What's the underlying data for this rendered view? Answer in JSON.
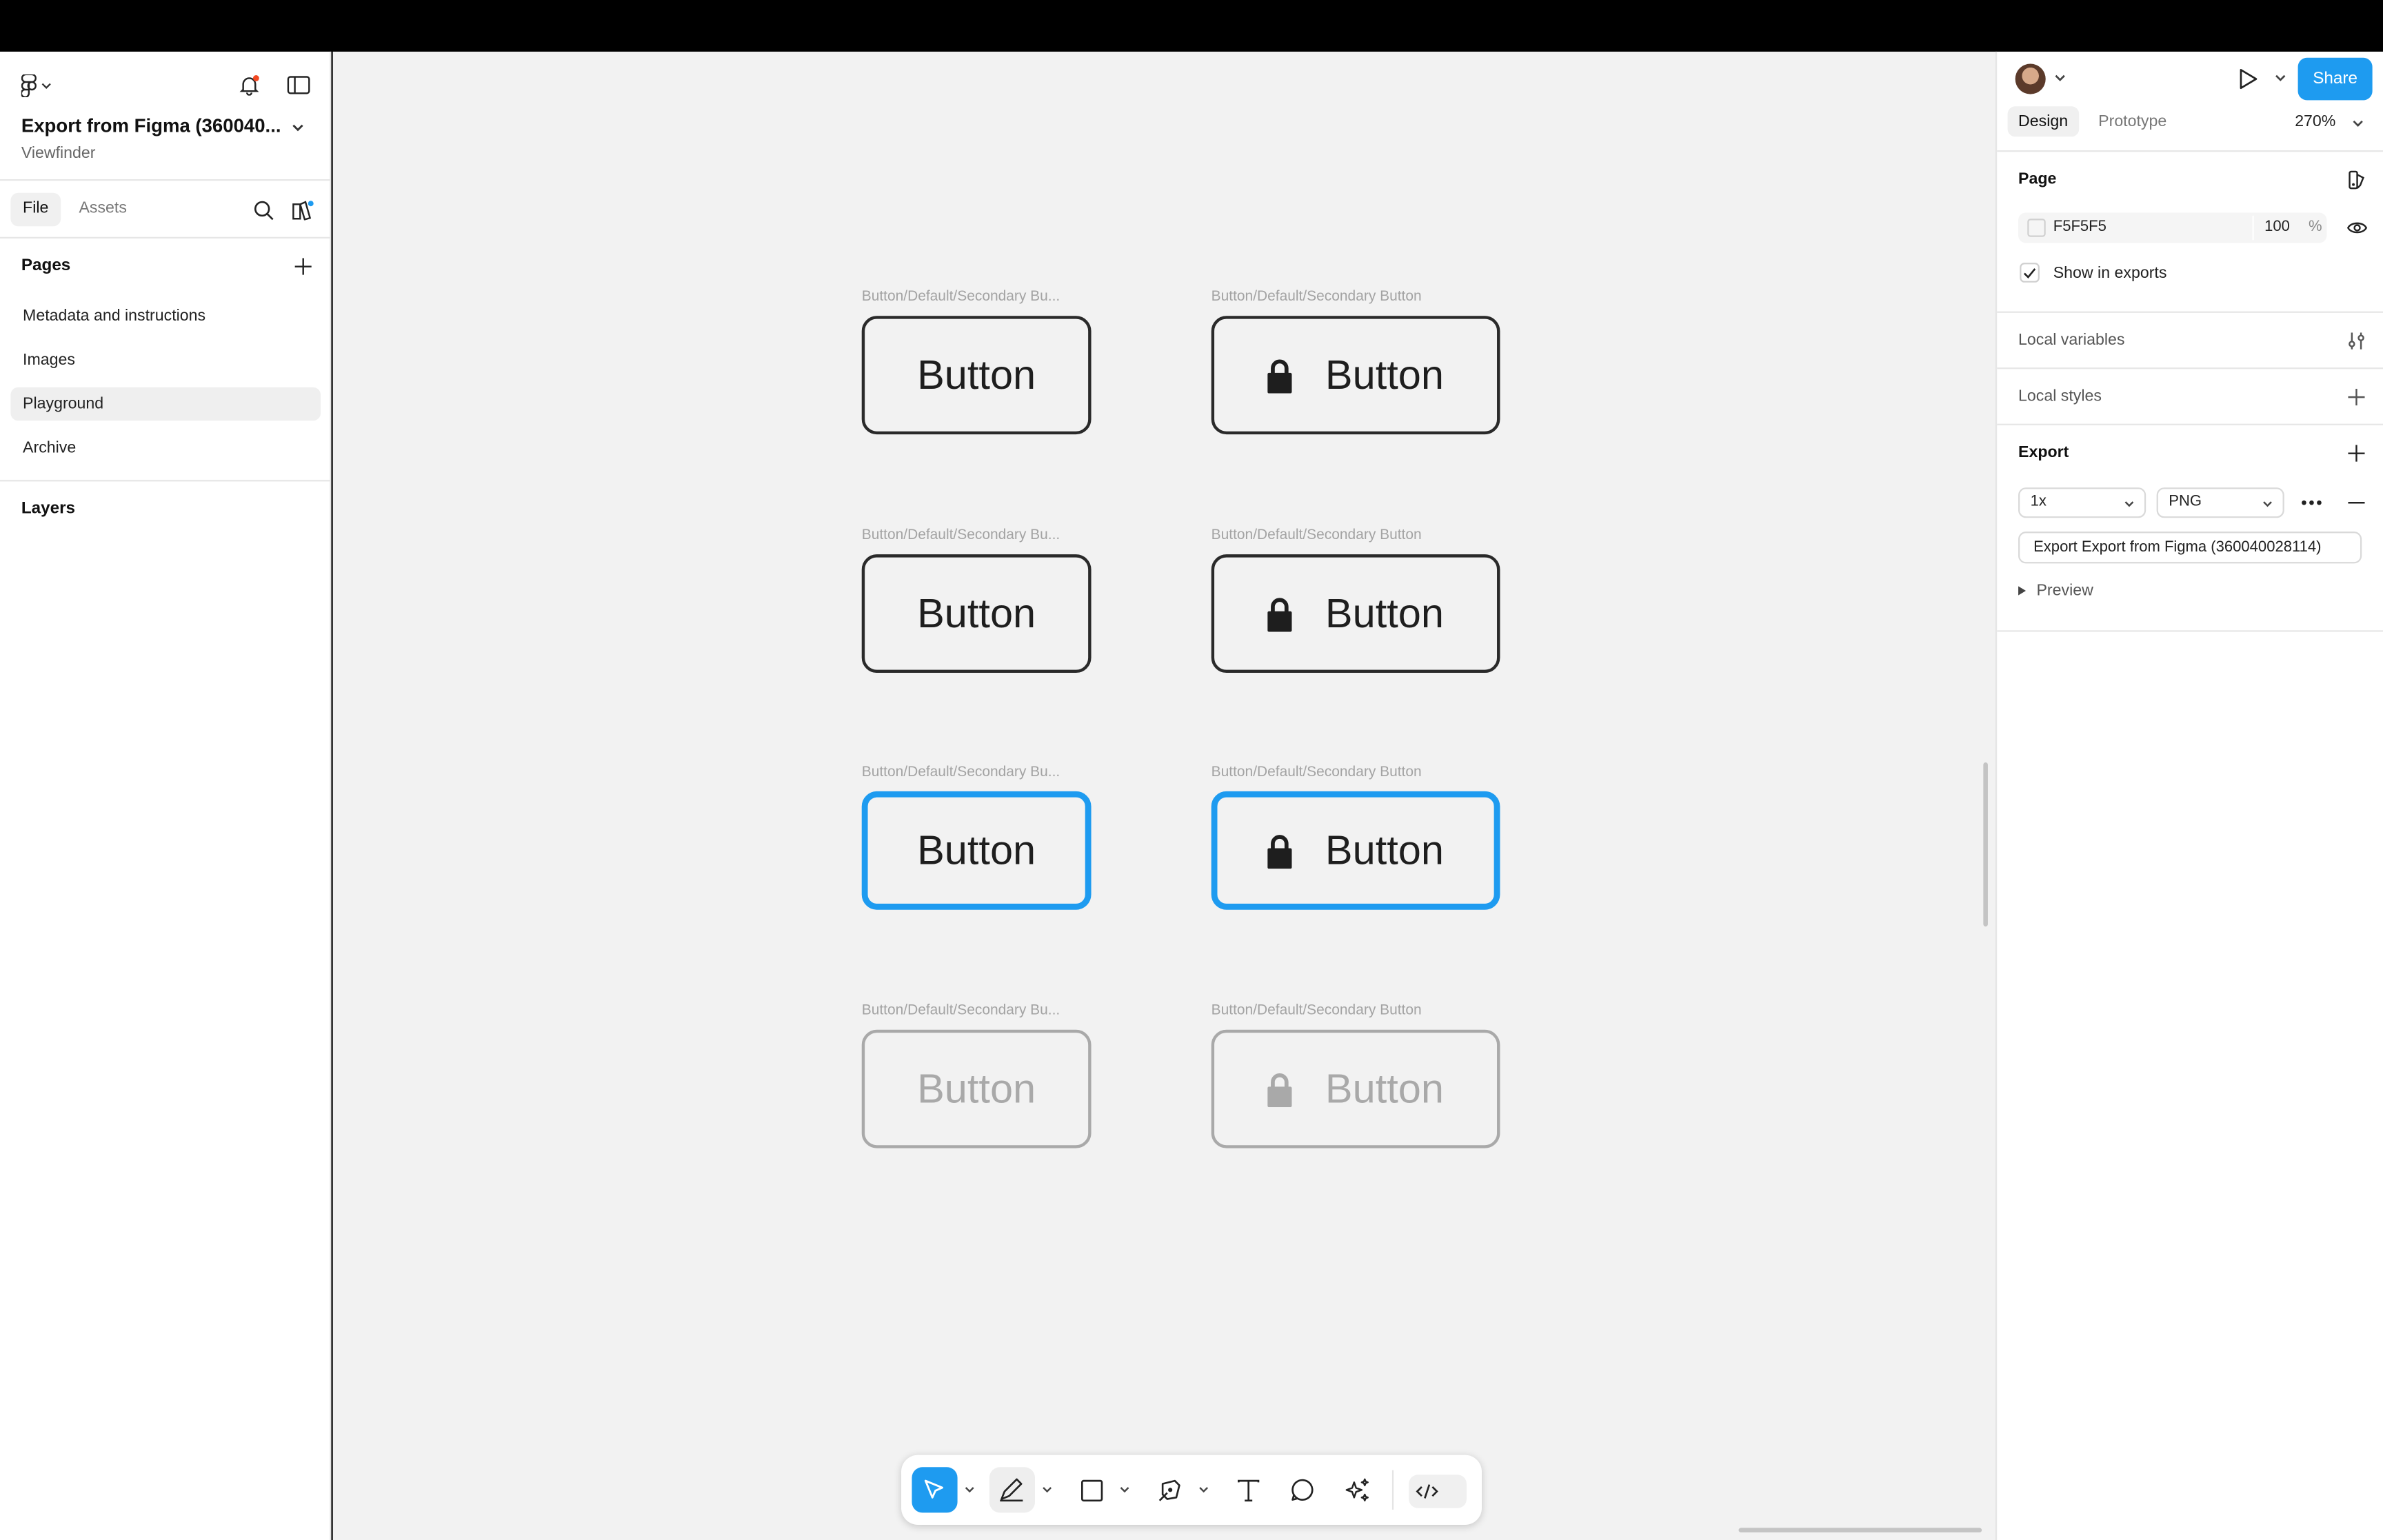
{
  "file": {
    "title": "Export from Figma (360040...",
    "subtitle": "Viewfinder",
    "tabs": [
      "File",
      "Assets"
    ]
  },
  "pages": {
    "heading": "Pages",
    "items": [
      "Metadata and instructions",
      "Images",
      "Playground",
      "Archive"
    ],
    "active": "Playground"
  },
  "layers": {
    "heading": "Layers"
  },
  "canvas": {
    "frames": [
      {
        "label": "Button/Default/Secondary Bu...",
        "text": "Button"
      },
      {
        "label": "Button/Default/Secondary Button",
        "text": "Button"
      },
      {
        "label": "Button/Default/Secondary Bu...",
        "text": "Button"
      },
      {
        "label": "Button/Default/Secondary Button",
        "text": "Button"
      },
      {
        "label": "Button/Default/Secondary Bu...",
        "text": "Button"
      },
      {
        "label": "Button/Default/Secondary Button",
        "text": "Button"
      },
      {
        "label": "Button/Default/Secondary Bu...",
        "text": "Button"
      },
      {
        "label": "Button/Default/Secondary Button",
        "text": "Button"
      }
    ]
  },
  "toolbar": {
    "tools": [
      "move-tool",
      "pencil-tool",
      "frame-tool",
      "pen-tool",
      "text-tool",
      "comment-tool",
      "actions-tool"
    ],
    "dev_mode": "code-icon"
  },
  "header_right": {
    "share_label": "Share"
  },
  "design_panel": {
    "tabs": [
      "Design",
      "Prototype"
    ],
    "zoom": "270%",
    "page_heading": "Page",
    "page_color": "F5F5F5",
    "page_opacity": "100",
    "percent_sign": "%",
    "show_in_exports": "Show in exports",
    "local_variables": "Local variables",
    "local_styles": "Local styles",
    "export_heading": "Export",
    "export_scale": "1x",
    "export_format": "PNG",
    "export_button": "Export Export from Figma (360040028114)",
    "preview_label": "Preview"
  },
  "help_label": "?",
  "colors": {
    "accent": "#1e9bf0",
    "canvas_bg": "#f2f2f2",
    "button_border": "#2a2a2a",
    "disabled": "#a9a9a9",
    "notification_dot": "#f24822"
  }
}
